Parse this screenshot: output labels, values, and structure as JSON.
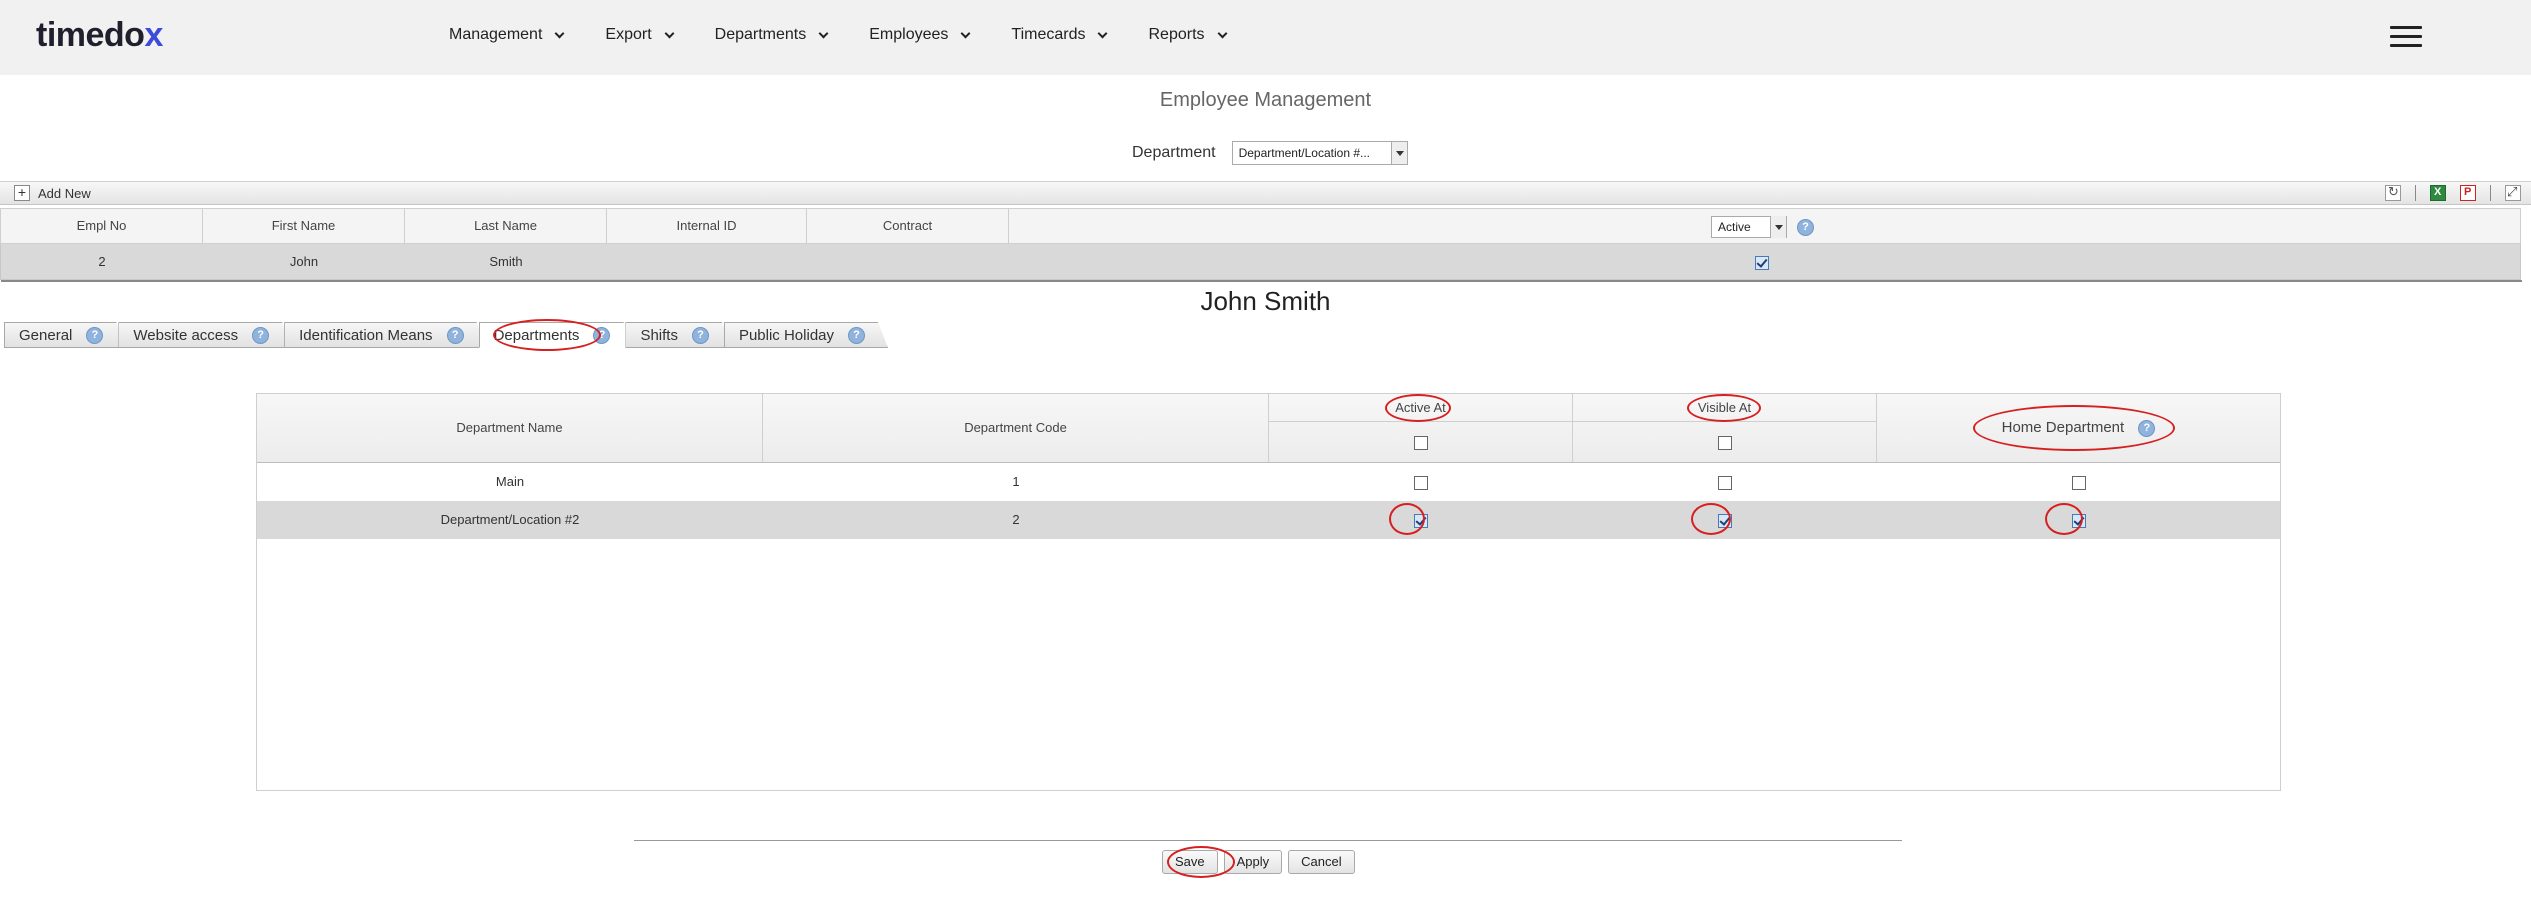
{
  "app": {
    "logo_text": "timedo",
    "logo_accent": "x",
    "logo_accent_color": "#3d4bd9"
  },
  "nav": {
    "items": [
      {
        "label": "Management"
      },
      {
        "label": "Export"
      },
      {
        "label": "Departments"
      },
      {
        "label": "Employees"
      },
      {
        "label": "Timecards"
      },
      {
        "label": "Reports"
      }
    ]
  },
  "page": {
    "title": "Employee Management"
  },
  "filter": {
    "label": "Department",
    "value": "Department/Location #..."
  },
  "grid": {
    "add_new_label": "Add New",
    "columns": [
      "Empl No",
      "First Name",
      "Last Name",
      "Internal ID",
      "Contract"
    ],
    "status_filter": "Active",
    "help_glyph": "?",
    "rows": [
      {
        "empl_no": "2",
        "first_name": "John",
        "last_name": "Smith",
        "internal_id": "",
        "contract": "",
        "active": true
      }
    ]
  },
  "employee": {
    "full_name": "John Smith"
  },
  "tabs": [
    {
      "label": "General",
      "active": false
    },
    {
      "label": "Website access",
      "active": false
    },
    {
      "label": "Identification Means",
      "active": false
    },
    {
      "label": "Departments",
      "active": true
    },
    {
      "label": "Shifts",
      "active": false
    },
    {
      "label": "Public Holiday",
      "active": false
    }
  ],
  "departments_table": {
    "headers": {
      "name": "Department Name",
      "code": "Department Code",
      "active_at": "Active At",
      "visible_at": "Visible At",
      "home": "Home Department"
    },
    "header_checks": {
      "active_at": false,
      "visible_at": false
    },
    "rows": [
      {
        "name": "Main",
        "code": "1",
        "active_at": false,
        "visible_at": false,
        "home": false,
        "selected": false
      },
      {
        "name": "Department/Location #2",
        "code": "2",
        "active_at": true,
        "visible_at": true,
        "home": true,
        "selected": true
      }
    ]
  },
  "actions": {
    "save": "Save",
    "apply": "Apply",
    "cancel": "Cancel"
  },
  "colors": {
    "highlight_ring": "#d62020",
    "selected_row": "#d9d9d9",
    "help_icon": "#8fb3dc"
  }
}
